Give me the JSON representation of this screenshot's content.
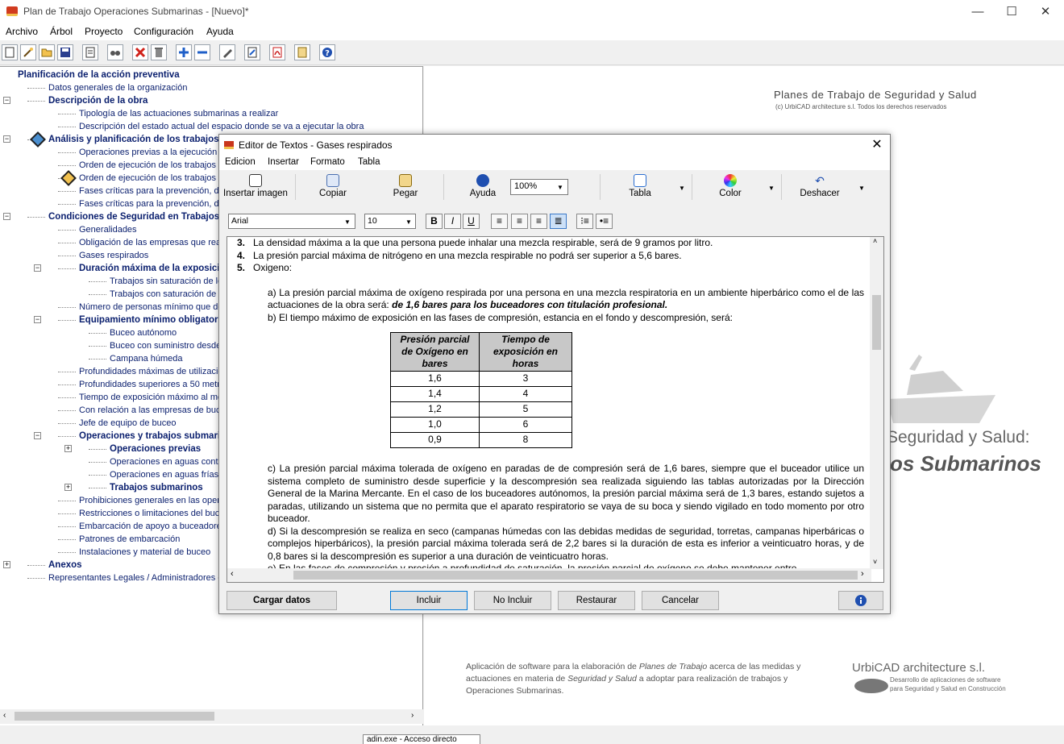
{
  "window": {
    "title": "Plan de Trabajo Operaciones Submarinas - [Nuevo]*",
    "minimize": "—",
    "maximize": "☐",
    "close": "✕"
  },
  "menu": [
    "Archivo",
    "Árbol",
    "Proyecto",
    "Configuración",
    "Ayuda"
  ],
  "toolbar_icons": [
    "new-doc-icon",
    "wizard-icon",
    "open-folder-icon",
    "save-icon",
    "preview-icon",
    "find-icon",
    "delete-icon",
    "trash-icon",
    "add-icon",
    "remove-icon",
    "edit-icon",
    "notes-icon",
    "pdf-icon",
    "document-icon",
    "help-icon"
  ],
  "tree": [
    {
      "label": "Planificación de la acción preventiva",
      "level": 0,
      "bold": true
    },
    {
      "label": "Datos generales de la organización",
      "level": 1,
      "bold": false
    },
    {
      "label": "Descripción de la obra",
      "level": 1,
      "bold": true
    },
    {
      "label": "Tipología de las actuaciones submarinas a realizar",
      "level": 2,
      "bold": false
    },
    {
      "label": "Descripción del estado actual del espacio donde se va a ejecutar la obra",
      "level": 2,
      "bold": false
    },
    {
      "label": "Análisis y planificación de los trabajos",
      "level": 1,
      "bold": true
    },
    {
      "label": "Operaciones previas a la ejecución de la obra",
      "level": 2,
      "bold": false
    },
    {
      "label": "Orden de ejecución de los trabajos - Descripción",
      "level": 2,
      "bold": false
    },
    {
      "label": "Orden de ejecución de los trabajos - Diagrama",
      "level": 2,
      "bold": false
    },
    {
      "label": "Fases críticas para la prevención, descripción",
      "level": 2,
      "bold": false
    },
    {
      "label": "Fases críticas para la prevención, detalle",
      "level": 2,
      "bold": false
    },
    {
      "label": "Condiciones de Seguridad en Trabajos Submarinos",
      "level": 1,
      "bold": true
    },
    {
      "label": "Generalidades",
      "level": 2,
      "bold": false
    },
    {
      "label": "Obligación de las empresas que realicen trabajos",
      "level": 2,
      "bold": false
    },
    {
      "label": "Gases respirados",
      "level": 2,
      "bold": false
    },
    {
      "label": "Duración máxima de la exposición",
      "level": 2,
      "bold": true
    },
    {
      "label": "Trabajos sin saturación de los tejidos",
      "level": 3,
      "bold": false
    },
    {
      "label": "Trabajos con saturación de los tejidos",
      "level": 3,
      "bold": false
    },
    {
      "label": "Número de personas mínimo que deben intervenir",
      "level": 2,
      "bold": false
    },
    {
      "label": "Equipamiento mínimo obligatorio",
      "level": 2,
      "bold": true
    },
    {
      "label": "Buceo autónomo",
      "level": 3,
      "bold": false
    },
    {
      "label": "Buceo con suministro desde superficie",
      "level": 3,
      "bold": false
    },
    {
      "label": "Campana húmeda",
      "level": 3,
      "bold": false
    },
    {
      "label": "Profundidades máximas de utilización",
      "level": 2,
      "bold": false
    },
    {
      "label": "Profundidades superiores a 50 metros",
      "level": 2,
      "bold": false
    },
    {
      "label": "Tiempo de exposición máximo al medio",
      "level": 2,
      "bold": false
    },
    {
      "label": "Con relación a las empresas de buceo",
      "level": 2,
      "bold": false
    },
    {
      "label": "Jefe de equipo de buceo",
      "level": 2,
      "bold": false
    },
    {
      "label": "Operaciones y trabajos submarinos",
      "level": 2,
      "bold": true
    },
    {
      "label": "Operaciones previas",
      "level": 3,
      "bold": true
    },
    {
      "label": "Operaciones en aguas contaminadas",
      "level": 3,
      "bold": false
    },
    {
      "label": "Operaciones en aguas frías",
      "level": 3,
      "bold": false
    },
    {
      "label": "Trabajos submarinos",
      "level": 3,
      "bold": true
    },
    {
      "label": "Prohibiciones generales en las operaciones",
      "level": 2,
      "bold": false
    },
    {
      "label": "Restricciones o limitaciones del buceo",
      "level": 2,
      "bold": false
    },
    {
      "label": "Embarcación de apoyo a buceadores",
      "level": 2,
      "bold": false
    },
    {
      "label": "Patrones de embarcación",
      "level": 2,
      "bold": false
    },
    {
      "label": "Instalaciones y material de buceo",
      "level": 2,
      "bold": false
    },
    {
      "label": "Anexos",
      "level": 1,
      "bold": true
    },
    {
      "label": "Representantes Legales / Administradores e",
      "level": 1,
      "bold": false
    }
  ],
  "branding": {
    "title": "Planes de Trabajo de Seguridad y Salud",
    "subtitle": "(c) UrbiCAD architecture s.l.   Todos los derechos reservados",
    "big_line1": "Seguridad y Salud:",
    "big_line2": "os Submarinos",
    "description_before": "Aplicación de software para la elaboración de ",
    "description_em1": "Planes de Trabajo",
    "description_mid": " acerca de las medidas y actuaciones en materia de ",
    "description_em2": "Seguridad y Salud",
    "description_after": " a adoptar para realización de trabajos y Operaciones Submarinas.",
    "company": "UrbiCAD architecture s.l.",
    "company_tag1": "Desarrollo de aplicaciones de software",
    "company_tag2": "para Seguridad y Salud en Construcción"
  },
  "status_tip": "adin.exe - Acceso directo",
  "dialog": {
    "title": "Editor de Textos - Gases respirados",
    "close": "✕",
    "menu": [
      "Edicion",
      "Insertar",
      "Formato",
      "Tabla"
    ],
    "ribbon": {
      "insert_image": "Insertar imagen",
      "copy": "Copiar",
      "paste": "Pegar",
      "help": "Ayuda",
      "zoom": "100%",
      "table": "Tabla",
      "color": "Color",
      "undo": "Deshacer"
    },
    "format": {
      "font": "Arial",
      "size": "10",
      "bold": "B",
      "italic": "I",
      "underline": "U"
    },
    "content": {
      "item3_num": "3.",
      "item3": "La densidad máxima a la que una persona puede inhalar una mezcla respirable, será de 9 gramos por litro.",
      "item4_num": "4.",
      "item4": "La presión parcial máxima de nitrógeno en una mezcla respirable no podrá ser superior a 5,6 bares.",
      "item5_num": "5.",
      "item5": "Oxigeno:",
      "para_a": "a) La presión parcial máxima de oxígeno respirada por una persona en una mezcla respiratoria en un ambiente hiperbárico como el de las actuaciones de la obra será: ",
      "para_a_em": "de 1,6 bares para los buceadores con titulación profesional.",
      "para_b": "b) El tiempo máximo de exposición en las fases de compresión, estancia en el fondo y descompresión, será:",
      "table_headers": [
        "Presión parcial de Oxígeno en bares",
        "Tiempo de exposición en horas"
      ],
      "table_rows": [
        [
          "1,6",
          "3"
        ],
        [
          "1,4",
          "4"
        ],
        [
          "1,2",
          "5"
        ],
        [
          "1,0",
          "6"
        ],
        [
          "0,9",
          "8"
        ]
      ],
      "para_c": "c) La presión parcial máxima tolerada de oxígeno en paradas de de compresión será de 1,6 bares, siempre que el buceador utilice un sistema completo de suministro desde superficie y la descompresión sea realizada siguiendo las tablas autorizadas por la Dirección General de la Marina Mercante. En el caso de los buceadores autónomos, la presión parcial máxima será de 1,3 bares, estando sujetos a paradas, utilizando un sistema que no permita que el aparato respiratorio se vaya de su boca y siendo vigilado en todo momento por otro buceador.",
      "para_d": "d) Si la descompresión se realiza en seco (campanas húmedas con las debidas medidas de seguridad, torretas, campanas hiperbáricas o complejos hiperbáricos), la presión parcial máxima tolerada será de 2,2 bares si la duración de esta es inferior a veinticuatro horas, y de 0,8 bares si la descompresión es superior a una duración de veinticuatro horas.",
      "para_e": "e) En las fases de compresión y presión a profundidad de saturación, la presión parcial de oxígeno se debe mantener entre"
    },
    "buttons": {
      "load": "Cargar datos",
      "include": "Incluir",
      "exclude": "No Incluir",
      "restore": "Restaurar",
      "cancel": "Cancelar"
    }
  }
}
